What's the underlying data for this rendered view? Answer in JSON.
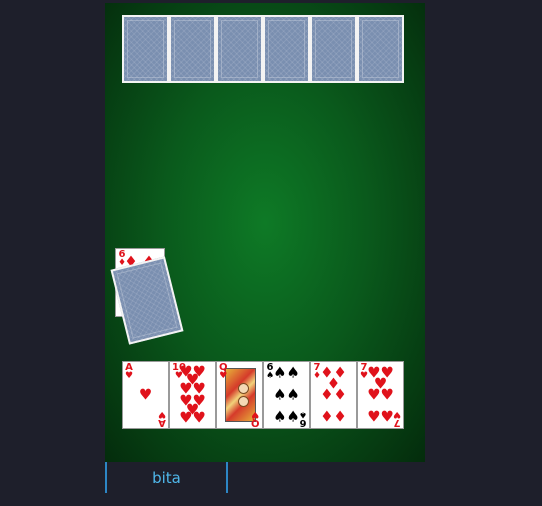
{
  "opponent_hand": {
    "card_count": 6
  },
  "trump": {
    "rank": "6",
    "suit_symbol": "♦",
    "color": "red"
  },
  "deck": {
    "state": "face-down"
  },
  "my_hand": [
    {
      "rank": "A",
      "suit_symbol": "♥",
      "color": "red",
      "kind": "ace"
    },
    {
      "rank": "10",
      "suit_symbol": "♥",
      "color": "red",
      "kind": "pips"
    },
    {
      "rank": "Q",
      "suit_symbol": "♥",
      "color": "red",
      "kind": "court"
    },
    {
      "rank": "6",
      "suit_symbol": "♠",
      "color": "black",
      "kind": "pips"
    },
    {
      "rank": "7",
      "suit_symbol": "♦",
      "color": "red",
      "kind": "pips"
    },
    {
      "rank": "7",
      "suit_symbol": "♥",
      "color": "red",
      "kind": "pips"
    }
  ],
  "actions": {
    "bita_label": "bita"
  },
  "colors": {
    "felt": "#0a5a1c",
    "background": "#1e1f2b",
    "accent": "#4fb7ea",
    "card_back": "#7a8fb0"
  }
}
